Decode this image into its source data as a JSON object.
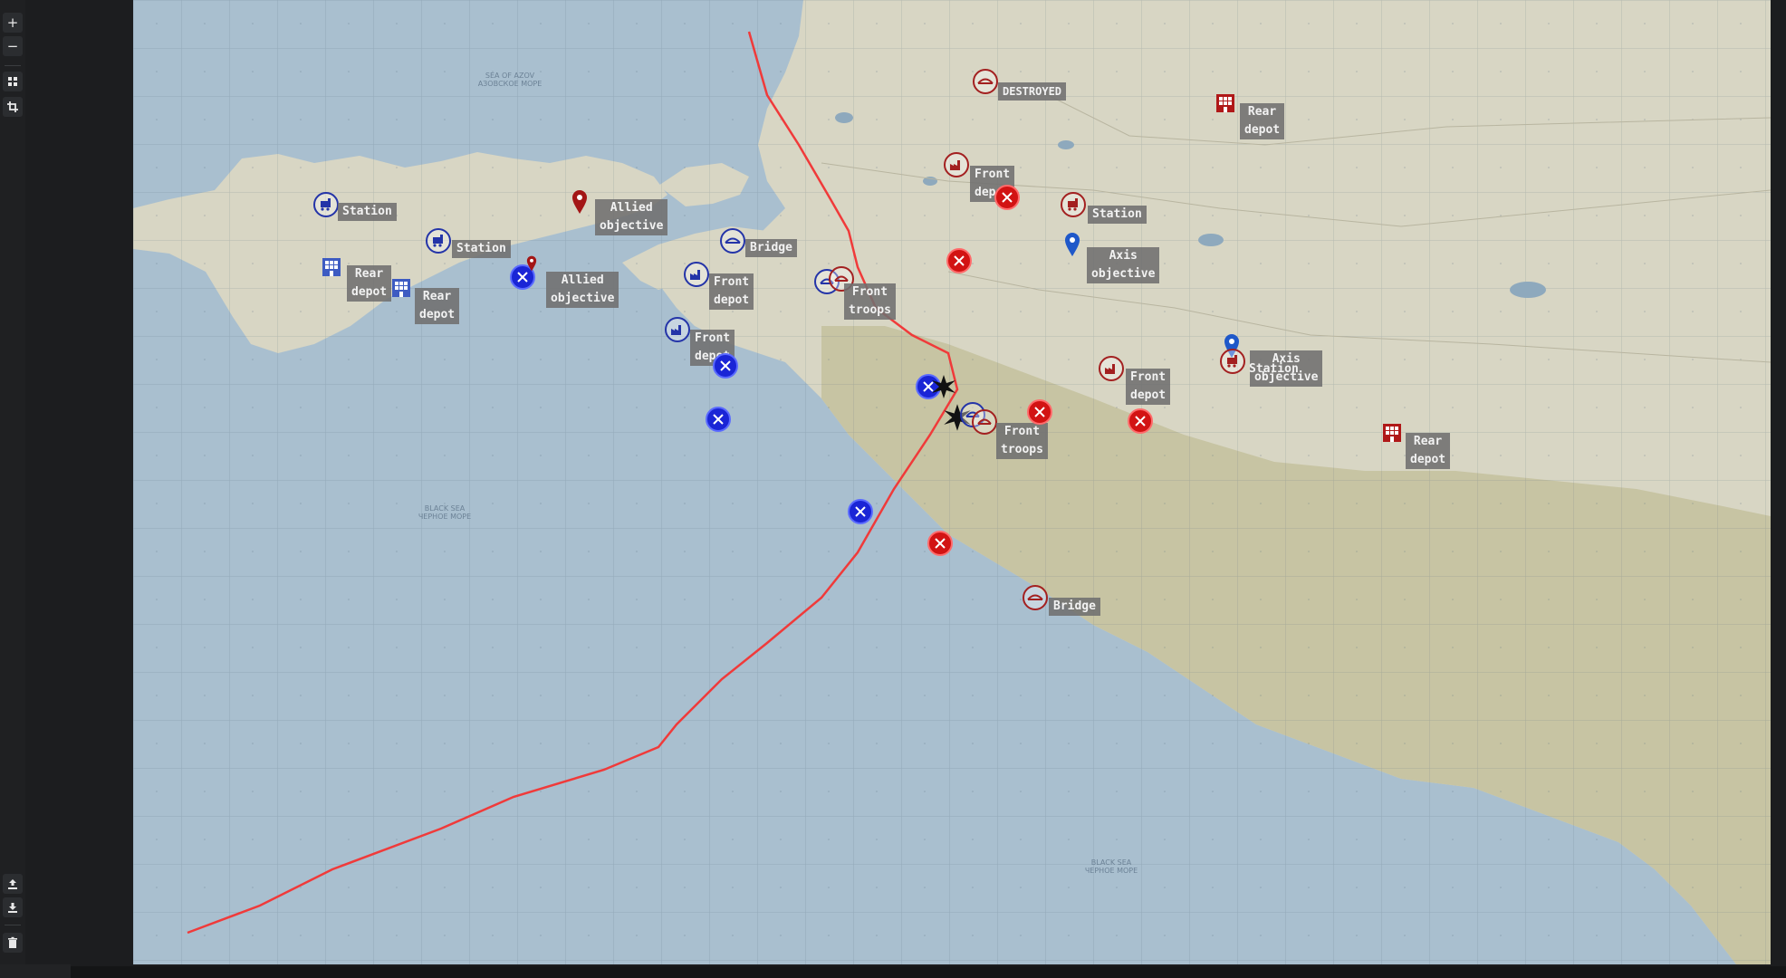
{
  "toolbar": {
    "zoom_in": "+",
    "zoom_out": "−",
    "layers": "layers-icon",
    "crop": "crop-icon",
    "upload": "upload-icon",
    "download": "download-icon",
    "delete": "trash-icon"
  },
  "map": {
    "water_labels": {
      "azov": "SEA OF AZOV\nАЗОВСКОЕ МОРЕ",
      "black_sea_1": "BLACK SEA\nЧЕРНОЕ МОРЕ",
      "black_sea_2": "BLACK SEA\nЧЕРНОЕ МОРЕ"
    },
    "colors": {
      "allied": "#1a25d6",
      "axis": "#d21313",
      "frontline": "#f03a3a",
      "water": "#a9bfcf",
      "land": "#d8d6c4"
    },
    "labels": {
      "station_1": "Station",
      "station_2": "Station",
      "rear_depot_1": "Rear\ndepot",
      "rear_depot_2": "Rear\ndepot",
      "allied_objective_1": "Allied\nobjective",
      "allied_objective_2": "Allied\nobjective",
      "bridge_1": "Bridge",
      "front_depot_1": "Front\ndepot",
      "front_depot_2": "Front\ndepot",
      "front_troops_1": "Front\ntroops",
      "destroyed": "DESTROYED",
      "rear_depot_3": "Rear\ndepot",
      "front_depot_3": "Front\ndepot",
      "station_3": "Station",
      "axis_objective_1": "Axis\nobjective",
      "axis_objective_2": "Axis\nobjective",
      "station_4": "Station",
      "front_depot_4": "Front\ndepot",
      "front_troops_2": "Front\ntroops",
      "rear_depot_4": "Rear\ndepot",
      "bridge_2": "Bridge"
    }
  }
}
